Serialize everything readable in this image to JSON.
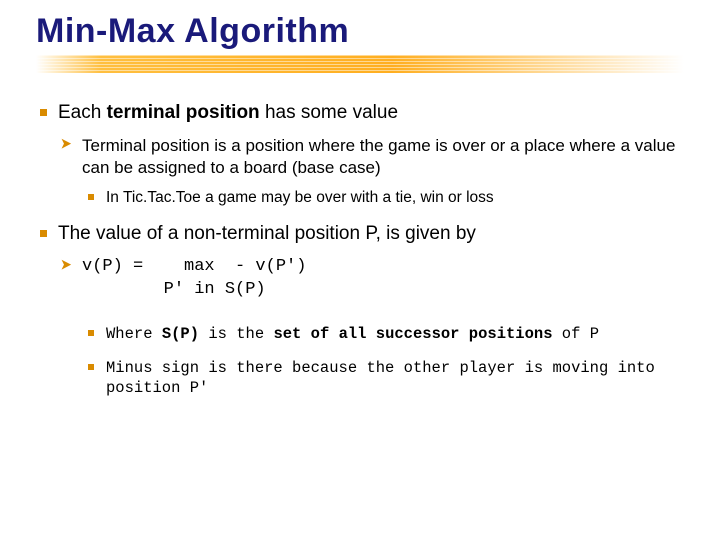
{
  "title": "Min-Max Algorithm",
  "bullets": {
    "b1": {
      "pre": "Each ",
      "bold": "terminal position",
      "post": " has some value",
      "sub": {
        "s1": {
          "text": "Terminal position is a position where the game is over or a place where a value can be assigned to a board (base case)",
          "subsub": {
            "t1": "In Tic.Tac.Toe a game may be over with a tie, win or loss"
          }
        }
      }
    },
    "b2": {
      "text": "The value of a non-terminal position P, is given by",
      "formula_line1": "v(P) =    max  - v(P')",
      "formula_line2": "        P' in S(P)",
      "subsub": {
        "w1_pre": "Where ",
        "w1_sp": "S(P)",
        "w1_mid": " is the ",
        "w1_bold": "set of all successor positions",
        "w1_post": " of P",
        "w2": "Minus sign is there because the other player is moving into position P'"
      }
    }
  }
}
